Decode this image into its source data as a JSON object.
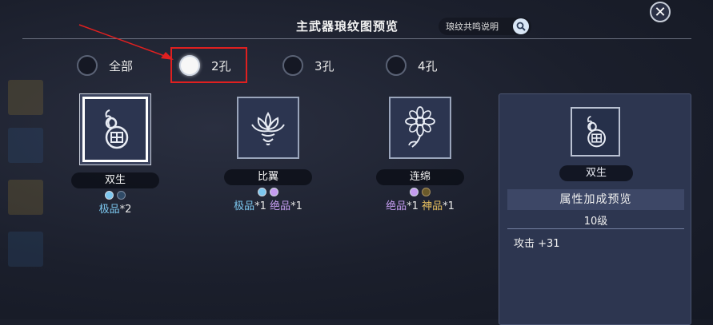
{
  "header": {
    "title": "主武器琅纹图预览",
    "explain_label": "琅纹共鸣说明"
  },
  "filters": [
    {
      "label": "全部",
      "selected": false
    },
    {
      "label": "2孔",
      "selected": true
    },
    {
      "label": "3孔",
      "selected": false
    },
    {
      "label": "4孔",
      "selected": false
    }
  ],
  "cards": [
    {
      "name": "双生",
      "icon": "gourd-icon",
      "selected": true,
      "gem_colors": [
        "#7cc7ef",
        "#2f4a66"
      ],
      "bonus": [
        {
          "grade": "极品",
          "count": "*2",
          "cls": "ji"
        }
      ]
    },
    {
      "name": "比翼",
      "icon": "lotus-icon",
      "selected": false,
      "gem_colors": [
        "#7cc7ef",
        "#c49cf0"
      ],
      "bonus": [
        {
          "grade": "极品",
          "count": "*1",
          "cls": "ji"
        },
        {
          "grade": "绝品",
          "count": "*1",
          "cls": "jue"
        }
      ]
    },
    {
      "name": "连绵",
      "icon": "flower-icon",
      "selected": false,
      "gem_colors": [
        "#c49cf0",
        "#6a5a2a"
      ],
      "bonus": [
        {
          "grade": "绝品",
          "count": "*1",
          "cls": "jue"
        },
        {
          "grade": "神品",
          "count": "*1",
          "cls": "shen"
        }
      ]
    }
  ],
  "preview": {
    "name": "双生",
    "attr_title": "属性加成预览",
    "level": "10级",
    "stat": "攻击 +31"
  },
  "colors": {
    "highlight": "#e02020",
    "ji": "#7cc7ef",
    "jue": "#c49cf0",
    "shen": "#e8c060"
  }
}
